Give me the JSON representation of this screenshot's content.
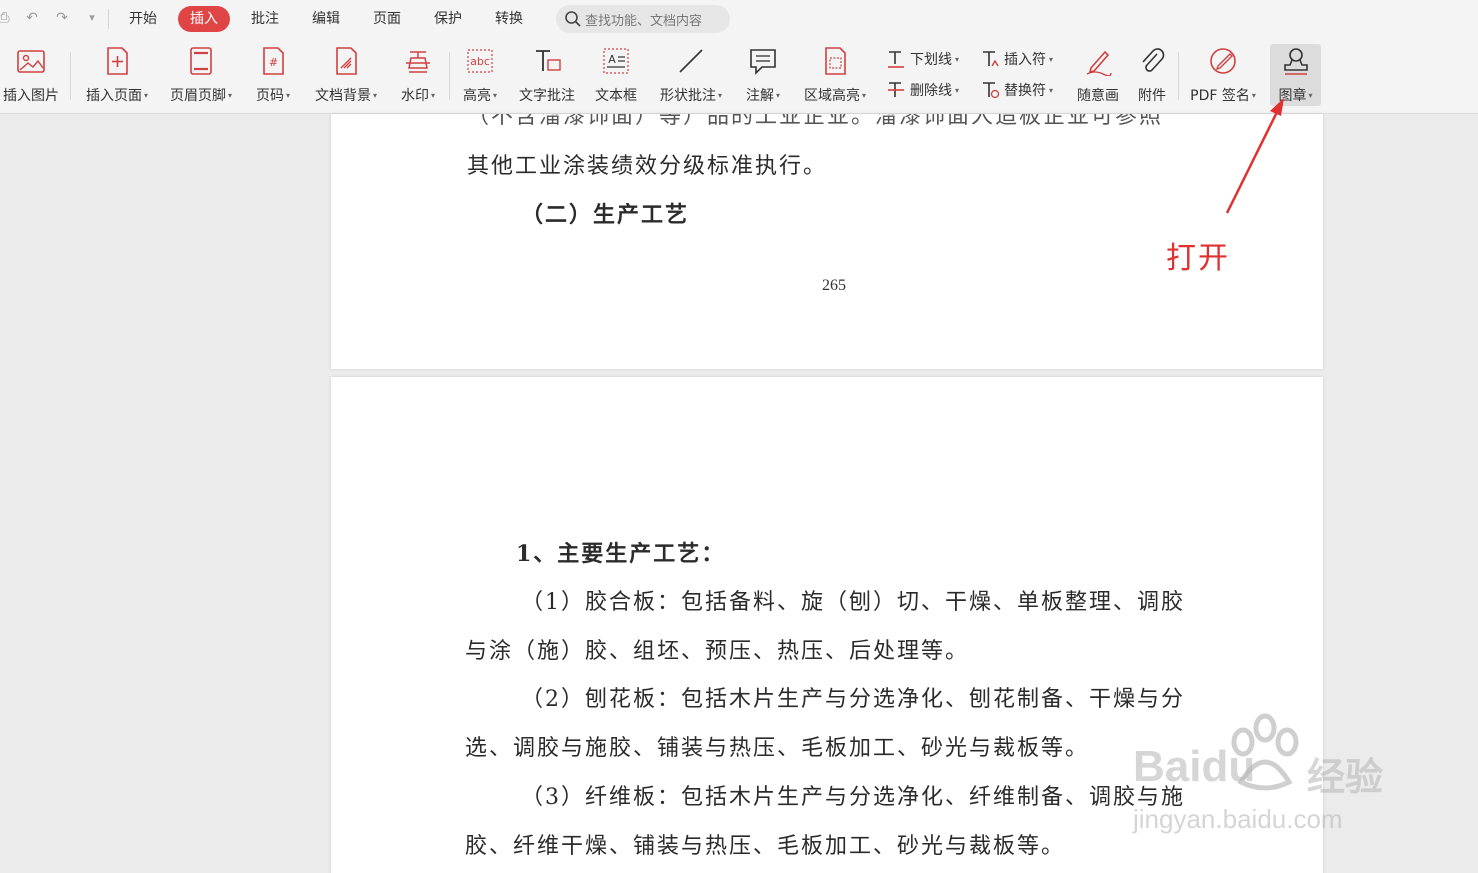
{
  "menu": {
    "tabs": [
      "开始",
      "插入",
      "批注",
      "编辑",
      "页面",
      "保护",
      "转换"
    ],
    "active_tab": "插入",
    "search_placeholder": "查找功能、文档内容"
  },
  "ribbon": {
    "insert_image": "插入图片",
    "insert_page": "插入页面",
    "header_footer": "页眉页脚",
    "page_number": "页码",
    "doc_background": "文档背景",
    "watermark": "水印",
    "highlight": "高亮",
    "text_comment": "文字批注",
    "text_box": "文本框",
    "shape_comment": "形状批注",
    "note": "注解",
    "area_highlight": "区域高亮",
    "underline": "下划线",
    "strikethrough": "删除线",
    "insert_mark": "插入符",
    "replace_mark": "替换符",
    "freehand": "随意画",
    "attachment": "附件",
    "pdf_sign": "PDF 签名",
    "stamp": "图章"
  },
  "page1": {
    "line_partial": "（不含溜漆饰面）等）品的工业企业。溜漆饰面人造板企业可参照",
    "line1": "其他工业涂装绩效分级标准执行。",
    "heading": "（二）生产工艺",
    "page_number": "265"
  },
  "page2": {
    "heading": "1、主要生产工艺：",
    "paragraphs": [
      "（1）胶合板：包括备料、旋（刨）切、干燥、单板整理、调胶",
      "与涂（施）胶、组坯、预压、热压、后处理等。",
      "（2）刨花板：包括木片生产与分选净化、刨花制备、干燥与分",
      "选、调胶与施胶、铺装与热压、毛板加工、砂光与裁板等。",
      "（3）纤维板：包括木片生产与分选净化、纤维制备、调胶与施",
      "胶、纤维干燥、铺装与热压、毛板加工、砂光与裁板等。"
    ]
  },
  "annotation": {
    "text": "打开",
    "color": "#e03030"
  },
  "watermark": {
    "brand": "Baidu",
    "brand_cn": "经验",
    "url": "jingyan.baidu.com"
  },
  "colors": {
    "accent": "#e04545",
    "toolbar_bg": "#f4f4f4",
    "workspace_bg": "#ebebeb"
  }
}
